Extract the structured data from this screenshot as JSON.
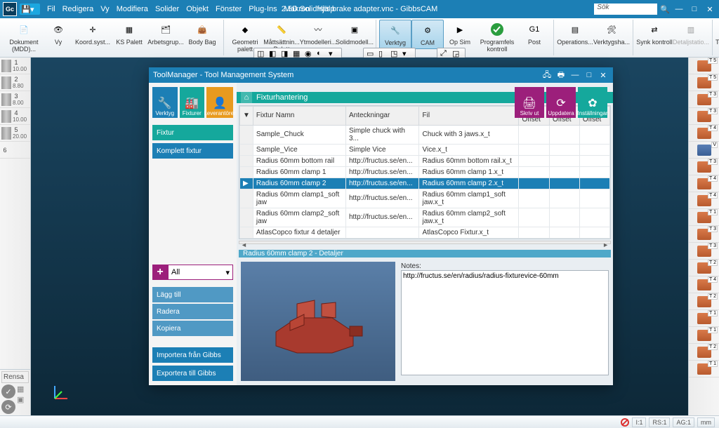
{
  "app": {
    "title_center": "2.5D Solidfräs brake adapter.vnc - GibbsCAM",
    "search_placeholder": "Sök"
  },
  "menu": [
    "Fil",
    "Redigera",
    "Vy",
    "Modifiera",
    "Solider",
    "Objekt",
    "Fönster",
    "Plug-Ins",
    "Makron",
    "Hjälp"
  ],
  "ribbon": [
    {
      "id": "doc",
      "label": "Dokument (MDD)..."
    },
    {
      "id": "vy",
      "label": "Vy"
    },
    {
      "id": "koord",
      "label": "Koord.syst..."
    },
    {
      "id": "ks",
      "label": "KS Palett"
    },
    {
      "id": "arbets",
      "label": "Arbetsgrup..."
    },
    {
      "id": "body",
      "label": "Body Bag"
    },
    {
      "id": "geom",
      "label": "Geometri palett"
    },
    {
      "id": "matt",
      "label": "Måttsättnin... Palett"
    },
    {
      "id": "ytmod",
      "label": "Ytmodelleri..."
    },
    {
      "id": "solidmod",
      "label": "Solidmodell..."
    },
    {
      "id": "verktyg",
      "label": "Verktyg"
    },
    {
      "id": "cam",
      "label": "CAM"
    },
    {
      "id": "opsim",
      "label": "Op Sim"
    },
    {
      "id": "prog",
      "label": "Programfels kontroll"
    },
    {
      "id": "post",
      "label": "Post"
    },
    {
      "id": "operations",
      "label": "Operations..."
    },
    {
      "id": "verktygsha",
      "label": "Verktygsha..."
    },
    {
      "id": "synk",
      "label": "Synk kontroll"
    },
    {
      "id": "detalj",
      "label": "Detaljstatio..."
    },
    {
      "id": "toolmgr",
      "label": "ToolManager"
    }
  ],
  "left_tools": [
    {
      "n": "1",
      "s": "10.00"
    },
    {
      "n": "2",
      "s": "8.80"
    },
    {
      "n": "3",
      "s": "8.00"
    },
    {
      "n": "4",
      "s": "10.00"
    },
    {
      "n": "5",
      "s": "20.00"
    },
    {
      "n": "6",
      "s": ""
    }
  ],
  "rensa": "Rensa",
  "right_tools": [
    "T 5",
    "T 5",
    "T 3",
    "T 3",
    "T 4",
    "V",
    "T 3",
    "T 4",
    "T 4",
    "T 1",
    "T 3",
    "T 3",
    "T 2",
    "T 4",
    "T 2",
    "T 1",
    "T 1",
    "T 2",
    "T 1"
  ],
  "dialog": {
    "title": "ToolManager - Tool Management System",
    "tabs": {
      "verktyg": "Verktyg",
      "fixturer": "Fixturer",
      "lever": "Leverantörer"
    },
    "sidebar": {
      "fixtur": "Fixtur",
      "komplett": "Komplett fixtur"
    },
    "add_dropdown": "All",
    "actions": {
      "lagg": "Lägg till",
      "radera": "Radera",
      "kopiera": "Kopiera",
      "import": "Importera från Gibbs",
      "export": "Exportera till Gibbs"
    },
    "top_tiles": {
      "print": "Skriv ut",
      "update": "Uppdatera",
      "settings": "Inställningar"
    },
    "breadcrumb": "Fixturhantering",
    "headers": {
      "name": "Fixtur Namn",
      "ant": "Anteckningar",
      "fil": "Fil",
      "xo": "X-Offset",
      "yo": "Y-Offset",
      "zo": "Z-Offset"
    },
    "rows": [
      {
        "name": "Sample_Chuck",
        "ant": "Simple chuck with 3...",
        "fil": "Chuck with 3 jaws.x_t"
      },
      {
        "name": "Sample_Vice",
        "ant": "Simple Vice",
        "fil": "Vice.x_t"
      },
      {
        "name": "Radius 60mm bottom rail",
        "ant": "http://fructus.se/en...",
        "fil": "Radius 60mm bottom rail.x_t"
      },
      {
        "name": "Radius 60mm clamp 1",
        "ant": "http://fructus.se/en...",
        "fil": "Radius 60mm clamp 1.x_t"
      },
      {
        "name": "Radius 60mm clamp 2",
        "ant": "http://fructus.se/en...",
        "fil": "Radius 60mm clamp 2.x_t"
      },
      {
        "name": "Radius 60mm clamp1_soft jaw",
        "ant": "http://fructus.se/en...",
        "fil": "Radius 60mm clamp1_soft jaw.x_t"
      },
      {
        "name": "Radius 60mm clamp2_soft jaw",
        "ant": "http://fructus.se/en...",
        "fil": "Radius 60mm clamp2_soft jaw.x_t"
      },
      {
        "name": "AtlasCopco fixtur 4 detaljer",
        "ant": "",
        "fil": "AtlasCopco Fixtur.x_t"
      }
    ],
    "detail_header": "Radius 60mm clamp 2 - Detaljer",
    "notes_label": "Notes:",
    "notes_value": "http://fructus.se/en/radius/radius-fixturevice-60mm"
  },
  "status": {
    "a": "I:1",
    "b": "RS:1",
    "c": "AG:1",
    "d": "mm"
  }
}
